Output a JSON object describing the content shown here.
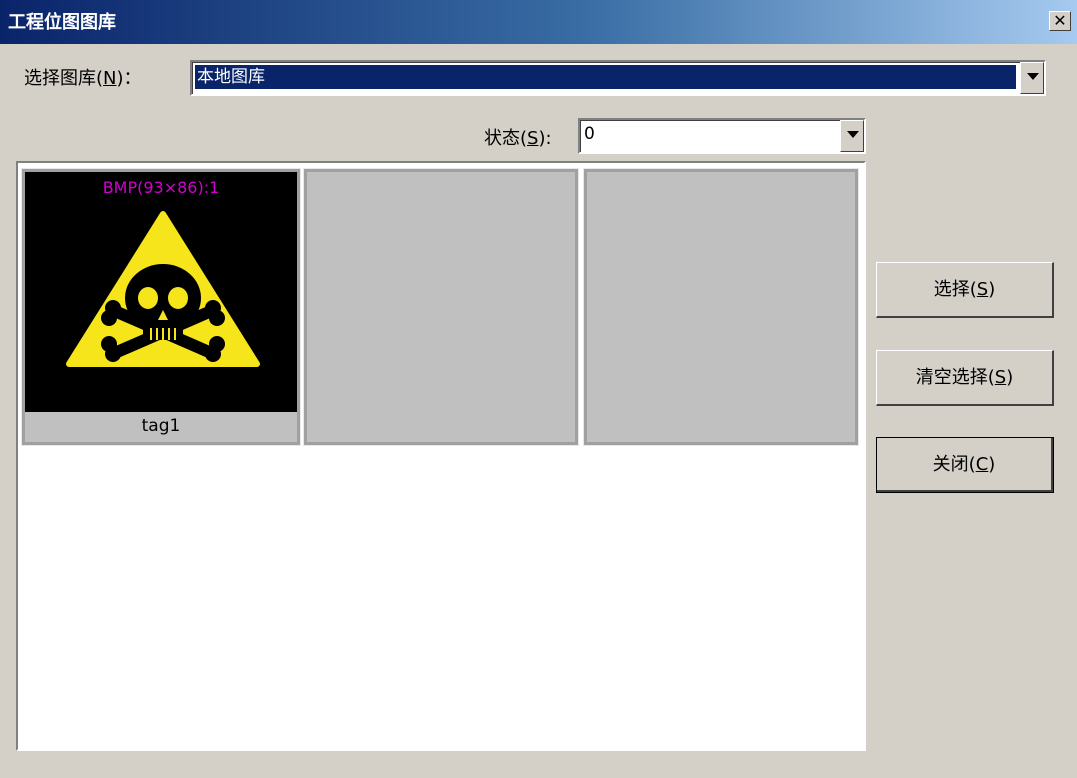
{
  "window": {
    "title": "工程位图图库",
    "close_glyph": "✕"
  },
  "library": {
    "label_text": "选择图库(",
    "label_key": "N",
    "label_suffix": ")：",
    "value": "本地图库"
  },
  "state": {
    "label_text": "状态(",
    "label_key": "S",
    "label_suffix": "):",
    "value": "0"
  },
  "gallery": {
    "items": [
      {
        "info": "BMP(93×86):1",
        "name": "tag1",
        "icon": "poison-skull-warning-icon"
      },
      {
        "info": "",
        "name": ""
      },
      {
        "info": "",
        "name": ""
      }
    ]
  },
  "buttons": {
    "select": {
      "text": "选择(",
      "key": "S",
      "suffix": ")"
    },
    "clear": {
      "text": "清空选择(",
      "key": "S",
      "suffix": ")"
    },
    "close": {
      "text": "关闭(",
      "key": "C",
      "suffix": ")"
    }
  },
  "colors": {
    "title_start": "#0a246a",
    "title_end": "#a6caf0",
    "info_text": "#d000d0",
    "warning_yellow": "#f5e51a"
  }
}
